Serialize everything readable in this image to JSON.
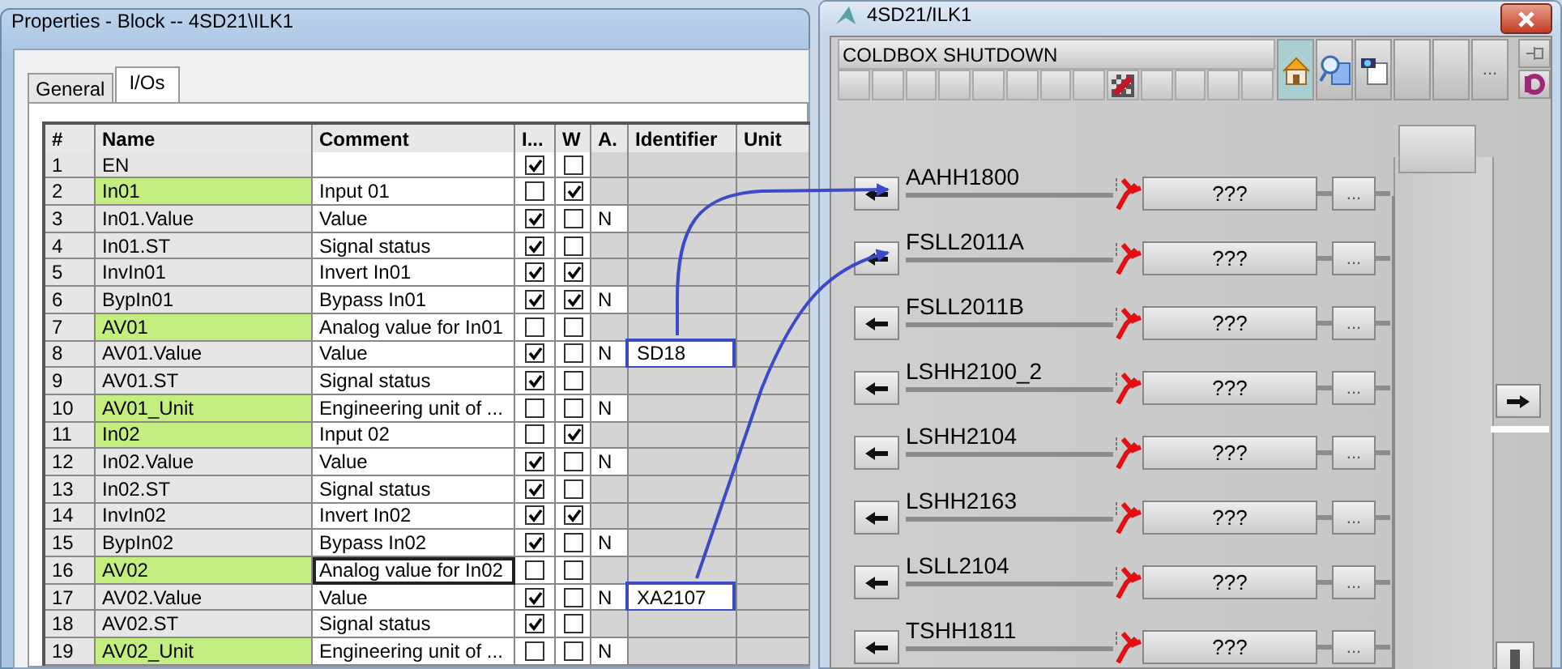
{
  "properties_window": {
    "title": "Properties - Block -- 4SD21\\ILK1",
    "tabs": [
      {
        "label": "General",
        "selected": false
      },
      {
        "label": "I/Os",
        "selected": true
      }
    ],
    "table": {
      "columns": [
        "#",
        "Name",
        "Comment",
        "I...",
        "W",
        "A.",
        "Identifier",
        "Unit"
      ],
      "rows": [
        {
          "no": "1",
          "name": "EN",
          "i": true,
          "w": false,
          "highlighted": false,
          "editing": false
        },
        {
          "no": "2",
          "name": "In01",
          "comment": "Input 01",
          "i": false,
          "w": true,
          "highlighted": true,
          "editing": false
        },
        {
          "no": "3",
          "name": "In01.Value",
          "comment": "Value",
          "i": true,
          "w": false,
          "a": "N",
          "highlighted": false,
          "editing": false
        },
        {
          "no": "4",
          "name": "In01.ST",
          "comment": "Signal status",
          "i": true,
          "w": false,
          "highlighted": false,
          "editing": false
        },
        {
          "no": "5",
          "name": "InvIn01",
          "comment": "Invert In01",
          "i": true,
          "w": true,
          "highlighted": false,
          "editing": false
        },
        {
          "no": "6",
          "name": "BypIn01",
          "comment": "Bypass In01",
          "i": true,
          "w": true,
          "a": "N",
          "highlighted": false,
          "editing": false
        },
        {
          "no": "7",
          "name": "AV01",
          "comment": "Analog value for In01",
          "i": false,
          "w": false,
          "highlighted": true,
          "editing": false
        },
        {
          "no": "8",
          "name": "AV01.Value",
          "comment": "Value",
          "i": true,
          "w": false,
          "a": "N",
          "identifier": "SD18",
          "highlighted": false,
          "editing": false
        },
        {
          "no": "9",
          "name": "AV01.ST",
          "comment": "Signal status",
          "i": true,
          "w": false,
          "highlighted": false,
          "editing": false
        },
        {
          "no": "10",
          "name": "AV01_Unit",
          "comment": "Engineering unit of ...",
          "i": false,
          "w": false,
          "a": "N",
          "highlighted": true,
          "editing": false
        },
        {
          "no": "11",
          "name": "In02",
          "comment": "Input 02",
          "i": false,
          "w": true,
          "highlighted": true,
          "editing": false
        },
        {
          "no": "12",
          "name": "In02.Value",
          "comment": "Value",
          "i": true,
          "w": false,
          "a": "N",
          "highlighted": false,
          "editing": false
        },
        {
          "no": "13",
          "name": "In02.ST",
          "comment": "Signal status",
          "i": true,
          "w": false,
          "highlighted": false,
          "editing": false
        },
        {
          "no": "14",
          "name": "InvIn02",
          "comment": "Invert In02",
          "i": true,
          "w": true,
          "highlighted": false,
          "editing": false
        },
        {
          "no": "15",
          "name": "BypIn02",
          "comment": "Bypass In02",
          "i": true,
          "w": false,
          "a": "N",
          "highlighted": false,
          "editing": false
        },
        {
          "no": "16",
          "name": "AV02",
          "comment": "Analog value for In02",
          "i": false,
          "w": false,
          "highlighted": true,
          "editing": true
        },
        {
          "no": "17",
          "name": "AV02.Value",
          "comment": "Value",
          "i": true,
          "w": false,
          "a": "N",
          "identifier": "XA2107",
          "highlighted": false,
          "editing": false
        },
        {
          "no": "18",
          "name": "AV02.ST",
          "comment": "Signal status",
          "i": true,
          "w": false,
          "highlighted": false,
          "editing": false
        },
        {
          "no": "19",
          "name": "AV02_Unit",
          "comment": "Engineering unit of ...",
          "i": false,
          "w": false,
          "a": "N",
          "highlighted": true,
          "editing": false
        }
      ]
    }
  },
  "faceplate": {
    "title": "4SD21/ILK1",
    "header": "COLDBOX SHUTDOWN",
    "status_buttons": [
      {
        "kind": "blank"
      },
      {
        "kind": "blank"
      },
      {
        "kind": "blank"
      },
      {
        "kind": "blank"
      },
      {
        "kind": "blank"
      },
      {
        "kind": "blank"
      },
      {
        "kind": "blank"
      },
      {
        "kind": "blank"
      },
      {
        "kind": "maintenance"
      },
      {
        "kind": "blank"
      },
      {
        "kind": "blank"
      },
      {
        "kind": "blank"
      },
      {
        "kind": "blank"
      }
    ],
    "tools": [
      {
        "kind": "home",
        "selected": true
      },
      {
        "kind": "zoom",
        "selected": false
      },
      {
        "kind": "camera",
        "selected": false
      },
      {
        "kind": "blank",
        "selected": false
      },
      {
        "kind": "blank",
        "selected": false
      },
      {
        "kind": "more",
        "label": "...",
        "selected": false
      }
    ],
    "signals": [
      {
        "name": "AAHH1800",
        "value": "???",
        "button": "..."
      },
      {
        "name": "FSLL2011A",
        "value": "???",
        "button": "..."
      },
      {
        "name": "FSLL2011B",
        "value": "???",
        "button": "..."
      },
      {
        "name": "LSHH2100_2",
        "value": "???",
        "button": "..."
      },
      {
        "name": "LSHH2104",
        "value": "???",
        "button": "..."
      },
      {
        "name": "LSHH2163",
        "value": "???",
        "button": "..."
      },
      {
        "name": "LSLL2104",
        "value": "???",
        "button": "..."
      },
      {
        "name": "TSHH1811",
        "value": "???",
        "button": "..."
      }
    ]
  }
}
